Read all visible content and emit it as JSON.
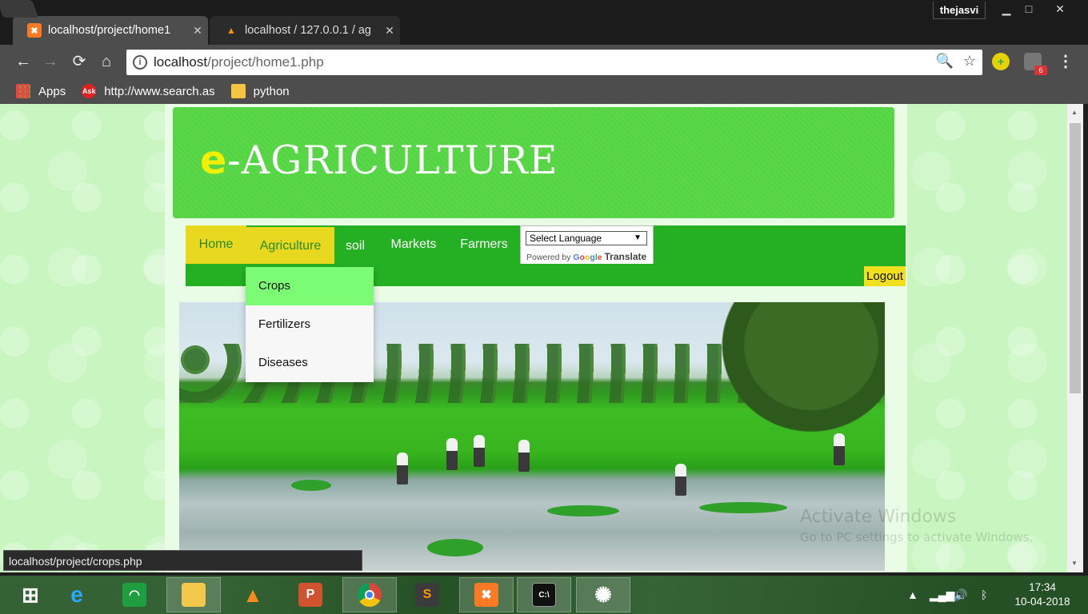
{
  "window": {
    "user": "thejasvi",
    "minimize_glyph": "▁",
    "maximize_glyph": "□",
    "close_glyph": "✕"
  },
  "tabs": [
    {
      "title": "localhost/project/home1",
      "favicon": "xampp-icon",
      "close": "✕"
    },
    {
      "title": "localhost / 127.0.0.1 / ag",
      "favicon": "phpmyadmin-icon",
      "close": "✕"
    }
  ],
  "toolbar": {
    "back": "←",
    "forward": "→",
    "reload": "⟳",
    "home": "⌂",
    "url_host": "localhost",
    "url_path": "/project/home1.php",
    "zoom_icon": "🔍",
    "star_icon": "☆",
    "extension_badge": "6",
    "menu": "⋮"
  },
  "bookmarks": [
    {
      "label": "Apps",
      "icon": "apps-icon"
    },
    {
      "label": "http://www.search.as",
      "icon": "ask-icon"
    },
    {
      "label": "python",
      "icon": "folder-icon"
    }
  ],
  "site": {
    "title_e": "e",
    "title_rest": "-AGRICULTURE",
    "nav": {
      "home": "Home",
      "agriculture": "Agriculture",
      "soil": "soil",
      "markets": "Markets",
      "farmers": "Farmers"
    },
    "translate": {
      "select_label": "Select Language",
      "arrow": "▼",
      "powered_by": "Powered by",
      "google": [
        "G",
        "o",
        "o",
        "g",
        "l",
        "e"
      ],
      "translate_word": "Translate"
    },
    "logout": "Logout",
    "dropdown": [
      "Crops",
      "Fertilizers",
      "Diseases"
    ]
  },
  "status_bar": "localhost/project/crops.php",
  "watermark": {
    "title": "Activate Windows",
    "subtitle": "Go to PC settings to activate Windows."
  },
  "taskbar": {
    "apps": [
      "windows-start-icon",
      "internet-explorer-icon",
      "app-green-icon",
      "file-explorer-icon",
      "vlc-icon",
      "powerpoint-icon",
      "chrome-icon",
      "sublime-text-icon",
      "xampp-icon",
      "command-prompt-icon",
      "web-spider-icon"
    ],
    "time": "17:34",
    "date": "10-04-2018"
  },
  "colors": {
    "header_green": "#55d544",
    "nav_green": "#25b024",
    "nav_active_yellow": "#e8d820",
    "dropdown_hover": "#7cfc74"
  }
}
